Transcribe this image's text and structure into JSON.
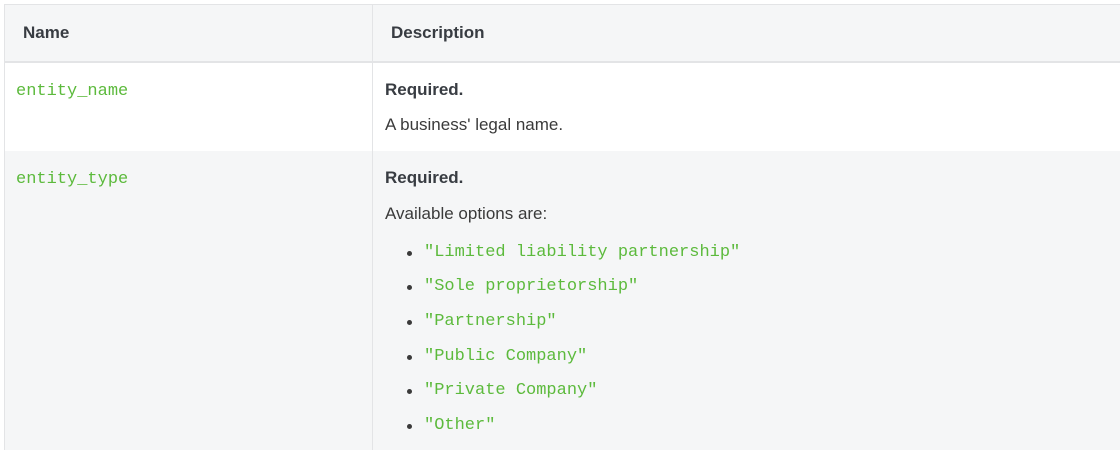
{
  "table": {
    "headers": {
      "name": "Name",
      "description": "Description"
    },
    "rows": [
      {
        "name": "entity_name",
        "required": "Required.",
        "text": "A business' legal name.",
        "options": []
      },
      {
        "name": "entity_type",
        "required": "Required.",
        "text": "Available options are:",
        "options": [
          "\"Limited liability partnership\"",
          "\"Sole proprietorship\"",
          "\"Partnership\"",
          "\"Public Company\"",
          "\"Private Company\"",
          "\"Other\""
        ]
      }
    ]
  },
  "colors": {
    "code": "#5cba3c",
    "header_bg": "#f5f6f7",
    "border": "#e3e4e6"
  }
}
